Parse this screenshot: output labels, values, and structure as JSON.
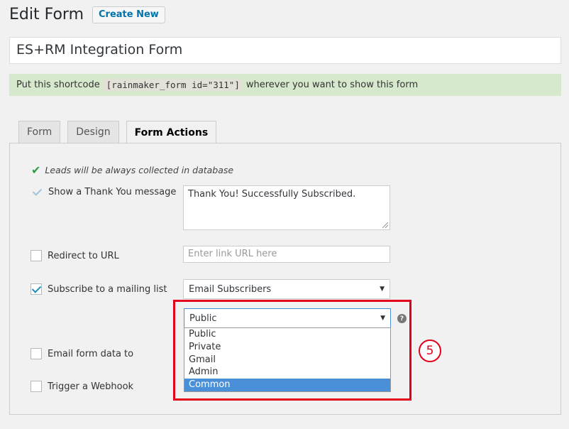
{
  "header": {
    "title": "Edit Form",
    "create_new_label": "Create New"
  },
  "form_title": "ES+RM Integration Form",
  "notice": {
    "before": "Put this shortcode",
    "shortcode": "[rainmaker_form id=\"311\"]",
    "after": "wherever you want to show this form"
  },
  "tabs": [
    {
      "label": "Form",
      "active": false
    },
    {
      "label": "Design",
      "active": false
    },
    {
      "label": "Form Actions",
      "active": true
    }
  ],
  "actions": {
    "leads_note": "Leads will be always collected in database",
    "thank_you": {
      "label": "Show a Thank You message",
      "checked": true,
      "message": "Thank You! Successfully Subscribed."
    },
    "redirect": {
      "label": "Redirect to URL",
      "checked": false,
      "placeholder": "Enter link URL here"
    },
    "mailing": {
      "label": "Subscribe to a mailing list",
      "checked": true,
      "list_value": "Email Subscribers",
      "status_value": "Public"
    },
    "email_data": {
      "label": "Email form data to",
      "checked": false
    },
    "webhook": {
      "label": "Trigger a Webhook",
      "checked": false
    }
  },
  "dropdown_options": [
    "Public",
    "Private",
    "Gmail",
    "Admin",
    "Common"
  ],
  "dropdown_highlighted": "Common",
  "step_number": "5",
  "colors": {
    "highlight": "#e3001b",
    "selected_option": "#4a90d9",
    "notice_bg": "#d7e9cd"
  }
}
